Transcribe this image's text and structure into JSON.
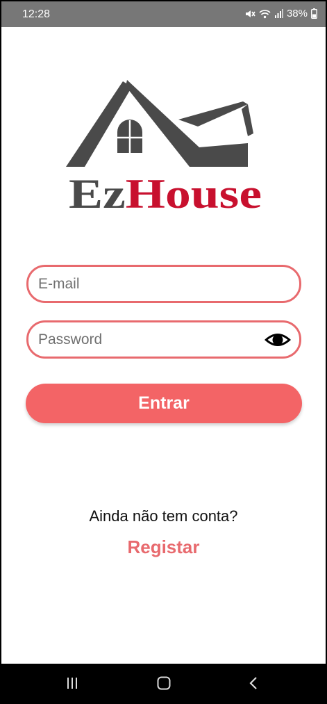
{
  "status_bar": {
    "time": "12:28",
    "battery": "38%",
    "icons": [
      "mute-icon",
      "wifi-icon",
      "signal-icon",
      "battery-icon"
    ]
  },
  "logo": {
    "prefix": "Ez",
    "suffix": "House",
    "icon": "house-roof-icon"
  },
  "login_form": {
    "email_placeholder": "E-mail",
    "password_placeholder": "Password",
    "show_password_icon": "eye-icon",
    "submit_label": "Entrar"
  },
  "signup": {
    "question": "Ainda não tem conta?",
    "link_label": "Registar"
  },
  "nav": {
    "icons": [
      "recent-apps-icon",
      "home-icon",
      "back-icon"
    ]
  },
  "colors": {
    "accent": "#f36466",
    "field_border": "#e86a6e",
    "logo_dark": "#4a4a4a",
    "logo_red": "#c8102e",
    "status_bar": "#777777",
    "nav_bar": "#000000"
  }
}
